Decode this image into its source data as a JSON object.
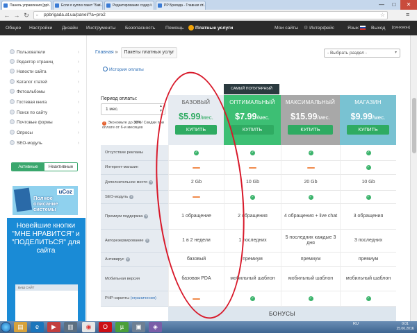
{
  "browser": {
    "tabs": [
      {
        "title": "Панель управления [pp...",
        "active": true
      },
      {
        "title": "Если я куплю пакет \"Баз...",
        "active": false
      },
      {
        "title": "Редактирование содер...",
        "active": false
      },
      {
        "title": "PP Бригада - Главная ст...",
        "active": false
      }
    ],
    "url": "ppbrigada.at.ua/panel/?a=pro2",
    "window_controls": [
      "—",
      "□",
      "✕"
    ]
  },
  "topnav": {
    "left": [
      "Общее",
      "Настройки",
      "Дизайн",
      "Инструменты",
      "Безопасность",
      "Помощь"
    ],
    "premium": "Платные услуги",
    "right": {
      "my_sites": "Мои сайты",
      "interface": "Интерфейс",
      "lang": "Язык",
      "logout": "Выход",
      "user": "[синхмон]"
    }
  },
  "sidebar": {
    "items": [
      "Пользователи",
      "Редактор страниц",
      "Новости сайта",
      "Каталог статей",
      "Фотоальбомы",
      "Гостевая книга",
      "Поиск по сайту",
      "Почтовые формы",
      "Опросы",
      "SEO-модуль"
    ],
    "seg_active": "Активные",
    "seg_inactive": "Неактивные",
    "ucoz_logo": "uCoz",
    "ucoz_text": "Полное описание системы",
    "banner_text": "Новейшие кнопки \"МНЕ НРАВИТСЯ\" и \"ПОДЕЛИТЬСЯ\" для сайта",
    "banner_mock": "ВАШ САЙТ"
  },
  "breadcrumb": {
    "home": "Главная",
    "sep": "»",
    "current": "Пакеты платных услуг"
  },
  "section_select": "- Выбрать раздел -",
  "history_link": "История оплаты",
  "period": {
    "label": "Период оплаты:",
    "value": "1 мес.",
    "hint_pre": "Экономьте до ",
    "hint_pct": "30%",
    "hint_post": "! Скидки при оплате от 6-и месяцев"
  },
  "popular_badge": "САМЫЙ ПОПУЛЯРНЫЙ",
  "buy_label": "КУПИТЬ",
  "plans": [
    {
      "name": "БАЗОВЫЙ",
      "price": "$5.99",
      "per": "/мес.",
      "head_bg": "#e6ebf1",
      "name_color": "#555",
      "price_color": "#2fab62"
    },
    {
      "name": "ОПТИМАЛЬНЫЙ",
      "price": "$7.99",
      "per": "/мес.",
      "head_bg": "#3dbf74",
      "name_color": "#fff",
      "price_color": "#fff"
    },
    {
      "name": "МАКСИМАЛЬНЫЙ",
      "price": "$15.99",
      "per": "/мес.",
      "head_bg": "#a8a8a8",
      "name_color": "#fff",
      "price_color": "#fff"
    },
    {
      "name": "МАГАЗИН",
      "price": "$9.99",
      "per": "/мес.",
      "head_bg": "#79c2d2",
      "name_color": "#fff",
      "price_color": "#fff"
    }
  ],
  "features": [
    {
      "label": "Отсутствие рекламы",
      "help": false,
      "values": [
        "check",
        "check",
        "check",
        "check"
      ]
    },
    {
      "label": "Интернет-магазин",
      "help": false,
      "values": [
        "dash",
        "dash",
        "dash",
        "check"
      ]
    },
    {
      "label": "Дополнительное место",
      "help": true,
      "values": [
        "2 Gb",
        "10 Gb",
        "20 Gb",
        "10 Gb"
      ]
    },
    {
      "label": "SEO-модуль",
      "help": true,
      "values": [
        "dash",
        "check",
        "check",
        "check"
      ]
    },
    {
      "label": "Премиум поддержка",
      "help": true,
      "values": [
        "1 обращение",
        "2 обращения",
        "4 обращения + live chat",
        "3 обращения"
      ]
    },
    {
      "label": "Авторезервирование",
      "help": true,
      "values": [
        "1 в 2 недели",
        "1 последних",
        "5 последних каждые 3 дня",
        "3 последних"
      ]
    },
    {
      "label": "Антивирус",
      "help": true,
      "values": [
        "базовый",
        "премиум",
        "премиум",
        "премиум"
      ]
    },
    {
      "label": "Мобильная версия",
      "help": false,
      "values": [
        "базовая PDA",
        "мобильный шаблон",
        "мобильный шаблон",
        "мобильный шаблон"
      ]
    },
    {
      "label": "PHP-скрипты",
      "help": false,
      "link": "(ограничения)",
      "values": [
        "dash",
        "check",
        "check",
        "check"
      ]
    }
  ],
  "bonus": "БОНУСЫ",
  "taskbar": {
    "lang": "RU",
    "time": "0:01",
    "date": "25.06.2016"
  }
}
